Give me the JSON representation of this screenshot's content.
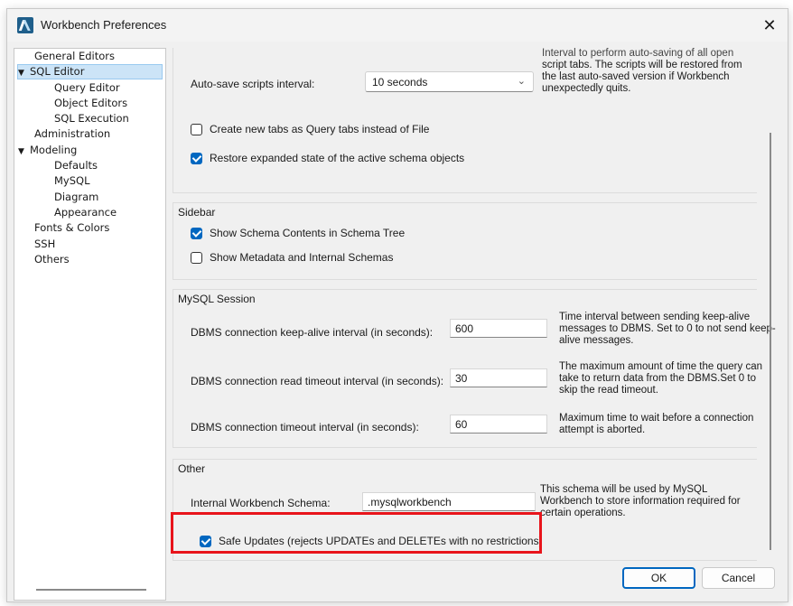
{
  "window": {
    "title": "Workbench Preferences",
    "close_glyph": "✕"
  },
  "sidebar": {
    "items": [
      {
        "label": "General Editors"
      },
      {
        "label": "SQL Editor",
        "arrow": "▼"
      },
      {
        "label": "Query Editor"
      },
      {
        "label": "Object Editors"
      },
      {
        "label": "SQL Execution"
      },
      {
        "label": "Administration"
      },
      {
        "label": "Modeling",
        "arrow": "▼"
      },
      {
        "label": "Defaults"
      },
      {
        "label": "MySQL"
      },
      {
        "label": "Diagram"
      },
      {
        "label": "Appearance"
      },
      {
        "label": "Fonts & Colors"
      },
      {
        "label": "SSH"
      },
      {
        "label": "Others"
      }
    ]
  },
  "sql_editor": {
    "autosave_label": "Auto-save scripts interval:",
    "autosave_value": "10 seconds",
    "autosave_desc_cut": "Interval to perform auto-saving of all open",
    "autosave_desc": "script tabs. The scripts will be restored from the last auto-saved version if Workbench unexpectedly quits.",
    "query_tabs_label": "Create new tabs as Query tabs instead of File",
    "query_tabs_checked": false,
    "restore_state_label": "Restore expanded state of the active schema objects",
    "restore_state_checked": true
  },
  "sidebar_group": {
    "title": "Sidebar",
    "show_schema_label": "Show Schema Contents in Schema Tree",
    "show_schema_checked": true,
    "show_metadata_label": "Show Metadata and Internal Schemas",
    "show_metadata_checked": false
  },
  "mysql_session": {
    "title": "MySQL Session",
    "keepalive_label": "DBMS connection keep-alive interval (in seconds):",
    "keepalive_value": "600",
    "keepalive_desc": "Time interval between sending keep-alive messages to DBMS. Set to 0 to not send keep-alive messages.",
    "read_timeout_label": "DBMS connection read timeout interval (in seconds):",
    "read_timeout_value": "30",
    "read_timeout_desc": "The maximum amount of time the query can take to return data from the DBMS.Set 0 to skip the read timeout.",
    "conn_timeout_label": "DBMS connection timeout interval (in seconds):",
    "conn_timeout_value": "60",
    "conn_timeout_desc": "Maximum time to wait before a connection attempt is aborted."
  },
  "other": {
    "title": "Other",
    "schema_label": "Internal Workbench Schema:",
    "schema_value": ".mysqlworkbench",
    "schema_desc": "This schema will be used by MySQL Workbench to store information required for certain operations.",
    "safe_updates_label": "Safe Updates (rejects UPDATEs and DELETEs with no restrictions)",
    "safe_updates_checked": true
  },
  "buttons": {
    "ok": "OK",
    "cancel": "Cancel"
  },
  "colors": {
    "accent": "#0067c0",
    "highlight": "#e8141b",
    "selection": "#cce4f7"
  }
}
